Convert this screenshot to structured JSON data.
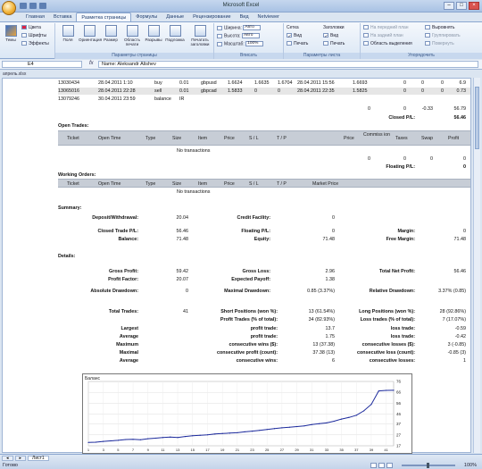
{
  "window": {
    "title": "Microsoft Excel"
  },
  "tabs": [
    "Главная",
    "Вставка",
    "Разметка страницы",
    "Формулы",
    "Данные",
    "Рецензирование",
    "Вид",
    "Netviewer"
  ],
  "ribbon": {
    "themes": {
      "themes_label": "Темы",
      "colors": "Цвета",
      "fonts": "Шрифты",
      "effects": "Эффекты"
    },
    "page_setup": {
      "group": "Параметры страницы",
      "margins": "Поля",
      "orientation": "Ориентация",
      "size": "Размер",
      "print_area": "Область печати",
      "breaks": "Разрывы",
      "background": "Подложка",
      "print_titles": "Печатать заголовки"
    },
    "fit": {
      "group": "Вписать",
      "width_label": "Ширина:",
      "width_value": "Авто",
      "height_label": "Высота:",
      "height_value": "Авто",
      "scale_label": "Масштаб:",
      "scale_value": "100%"
    },
    "sheet_options": {
      "group": "Параметры листа",
      "gridlines": "Сетка",
      "headings": "Заголовки",
      "view1": "Вид",
      "view2": "Вид",
      "print1": "Печать",
      "print2": "Печать"
    },
    "arrange": {
      "group": "Упорядочить",
      "front": "На передний план",
      "back": "На задний план",
      "selection_pane": "Область выделения",
      "align": "Выровнять",
      "group_btn": "Группировать",
      "rotate": "Повернуть"
    }
  },
  "formula_bar": {
    "name_box": "E4",
    "formula": "Name: Aleksandr Alishev"
  },
  "workbook": {
    "name": "апрель.xlsx"
  },
  "deals": [
    {
      "ticket": "13030434",
      "time": "28.04.2011 1:10",
      "type": "buy",
      "size": "0.01",
      "item": "gbpusd",
      "price": "1.6624",
      "sl": "1.6635",
      "tp": "1.6704",
      "close_time": "28.04.2011 15:56",
      "close_price": "1.6693",
      "comm": "0",
      "taxes": "0",
      "swap": "0",
      "profit": "6.9",
      "shaded": false
    },
    {
      "ticket": "13065016",
      "time": "28.04.2011 22:28",
      "type": "sell",
      "size": "0.01",
      "item": "gbpcad",
      "price": "1.5833",
      "sl": "0",
      "tp": "0",
      "close_time": "28.04.2011 22:35",
      "close_price": "1.5825",
      "comm": "0",
      "taxes": "0",
      "swap": "0",
      "profit": "0.73",
      "shaded": true
    },
    {
      "ticket": "13079246",
      "time": "30.04.2011 23:59",
      "type": "balance",
      "size": "IR",
      "item": "",
      "price": "",
      "sl": "",
      "tp": "",
      "close_time": "",
      "close_price": "",
      "comm": "",
      "taxes": "",
      "swap": "",
      "profit": "",
      "shaded": false
    }
  ],
  "totals_row": {
    "comm": "0",
    "taxes": "0",
    "swap": "-0.33",
    "profit": "56.79"
  },
  "closed_pl": {
    "label": "Closed P/L:",
    "value": "56.46"
  },
  "open_trades": {
    "title": "Open Trades:",
    "headers": [
      "Ticket",
      "Open Time",
      "Type",
      "Size",
      "Item",
      "Price",
      "S / L",
      "T / P",
      "Price",
      "Commiss ion",
      "Taxes",
      "Swap",
      "Profit"
    ],
    "no_tx": "No transactions",
    "totals": {
      "comm": "0",
      "taxes": "0",
      "swap": "0",
      "profit": "0"
    },
    "floating_label": "Floating P/L:",
    "floating_value": "0"
  },
  "working_orders": {
    "title": "Working Orders:",
    "headers": [
      "Ticket",
      "Open Time",
      "Type",
      "Size",
      "Item",
      "Price",
      "S / L",
      "T / P",
      "Market Price"
    ],
    "no_tx": "No transactions"
  },
  "summary": {
    "title": "Summary:",
    "deposit_label": "Deposit/Withdrawal:",
    "deposit_value": "20.04",
    "credit_label": "Credit Facility:",
    "credit_value": "0",
    "closed_label": "Closed Trade P/L:",
    "closed_value": "56.46",
    "floating_label": "Floating P/L:",
    "floating_value": "0",
    "margin_label": "Margin:",
    "margin_value": "0",
    "balance_label": "Balance:",
    "balance_value": "71.48",
    "equity_label": "Equity:",
    "equity_value": "71.48",
    "free_margin_label": "Free Margin:",
    "free_margin_value": "71.48"
  },
  "details": {
    "title": "Details:",
    "gross_profit_label": "Gross Profit:",
    "gross_profit_value": "59.42",
    "gross_loss_label": "Gross Loss:",
    "gross_loss_value": "2.96",
    "net_profit_label": "Total Net Profit:",
    "net_profit_value": "56.46",
    "profit_factor_label": "Profit Factor:",
    "profit_factor_value": "20.07",
    "expected_label": "Expected Payoff:",
    "expected_value": "1.38",
    "abs_dd_label": "Absolute Drawdown:",
    "abs_dd_value": "0",
    "max_dd_label": "Maximal Drawdown:",
    "max_dd_value": "0.85 (3.37%)",
    "rel_dd_label": "Relative Drawdown:",
    "rel_dd_value": "3.37% (0.85)",
    "total_trades_label": "Total Trades:",
    "total_trades_value": "41",
    "short_label": "Short Positions (won %):",
    "short_value": "13 (61.54%)",
    "long_label": "Long Positions (won %):",
    "long_value": "28 (92.86%)",
    "profit_trades_label": "Profit Trades (% of total):",
    "profit_trades_value": "34 (82.93%)",
    "loss_trades_label": "Loss trades (% of total):",
    "loss_trades_value": "7 (17.07%)",
    "largest_label": "Largest",
    "largest_profit_label": "profit trade:",
    "largest_profit_value": "13.7",
    "largest_loss_label": "loss trade:",
    "largest_loss_value": "-0.59",
    "average_label": "Average",
    "avg_profit_label": "profit trade:",
    "avg_profit_value": "1.75",
    "avg_loss_label": "loss trade:",
    "avg_loss_value": "-0.42",
    "maximum_label": "Maximum",
    "max_wins_label": "consecutive wins ($):",
    "max_wins_value": "13 (37.38)",
    "max_losses_label": "consecutive losses ($):",
    "max_losses_value": "3 (-0.85)",
    "maximal_label": "Maximal",
    "maximal_profit_label": "consecutive profit (count):",
    "maximal_profit_value": "37.38 (13)",
    "maximal_loss_label": "consecutive loss (count):",
    "maximal_loss_value": "-0.85 (3)",
    "average2_label": "Average",
    "avg_wins_label": "consecutive wins:",
    "avg_wins_value": "6",
    "avg_losses_label": "consecutive losses:",
    "avg_losses_value": "1"
  },
  "chart_data": {
    "type": "line",
    "title": "Баланс",
    "x": [
      1,
      2,
      3,
      4,
      5,
      6,
      7,
      8,
      9,
      10,
      11,
      12,
      13,
      14,
      15,
      16,
      17,
      18,
      19,
      20,
      21,
      22,
      23,
      24,
      25,
      26,
      27,
      28,
      29,
      30,
      31,
      32,
      33,
      34,
      35,
      36,
      37,
      38,
      39,
      40,
      41,
      42
    ],
    "y": [
      20.04,
      20.3,
      21.0,
      21.5,
      22.0,
      22.7,
      22.9,
      22.5,
      23.5,
      24.0,
      24.6,
      25.0,
      24.6,
      25.5,
      26.2,
      26.6,
      27.1,
      27.8,
      28.2,
      28.6,
      29.0,
      29.8,
      30.4,
      31.2,
      32.0,
      32.8,
      33.5,
      34.0,
      34.6,
      35.3,
      36.4,
      37.2,
      38.0,
      39.5,
      41.5,
      43.0,
      45.0,
      49.0,
      55.0,
      67.3,
      67.8,
      67.9
    ],
    "xticks": [
      "1",
      "3",
      "5",
      "7",
      "9",
      "11",
      "13",
      "15",
      "17",
      "19",
      "21",
      "23",
      "25",
      "27",
      "29",
      "31",
      "33",
      "35",
      "37",
      "39",
      "41"
    ],
    "yticks": [
      "17",
      "27",
      "37",
      "46",
      "56",
      "66",
      "76"
    ],
    "ylim": [
      17,
      76
    ],
    "color": "#1c2a9c",
    "grid": true
  },
  "statusbar": {
    "ready": "Готово",
    "zoom": "100%",
    "sheet_tabs": [
      "Лист1"
    ]
  }
}
